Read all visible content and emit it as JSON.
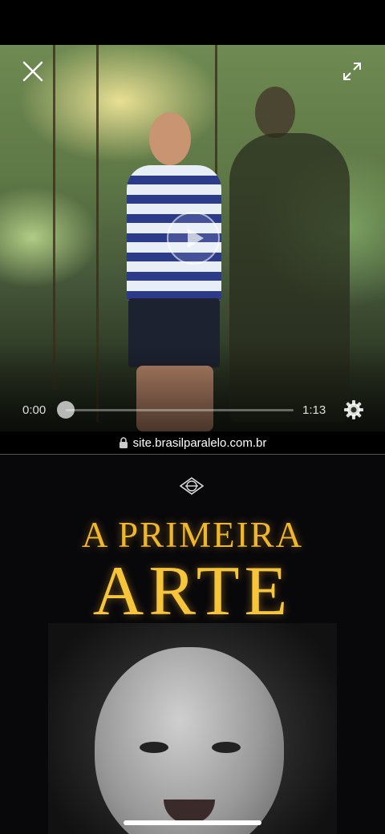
{
  "video": {
    "time_current": "0:00",
    "time_total": "1:13",
    "progress": 0.0,
    "icons": {
      "close": "close-icon",
      "expand": "expand-icon",
      "play": "play-icon",
      "settings": "gear-icon"
    }
  },
  "browser": {
    "url": "site.brasilparalelo.com.br",
    "lock_icon": "lock-icon"
  },
  "promo": {
    "logo_icon": "brasil-paralelo-logo",
    "headline_line1": "A PRIMEIRA",
    "headline_line2": "ARTE"
  },
  "colors": {
    "headline_gold": "#f1b72a",
    "background": "#000000"
  }
}
